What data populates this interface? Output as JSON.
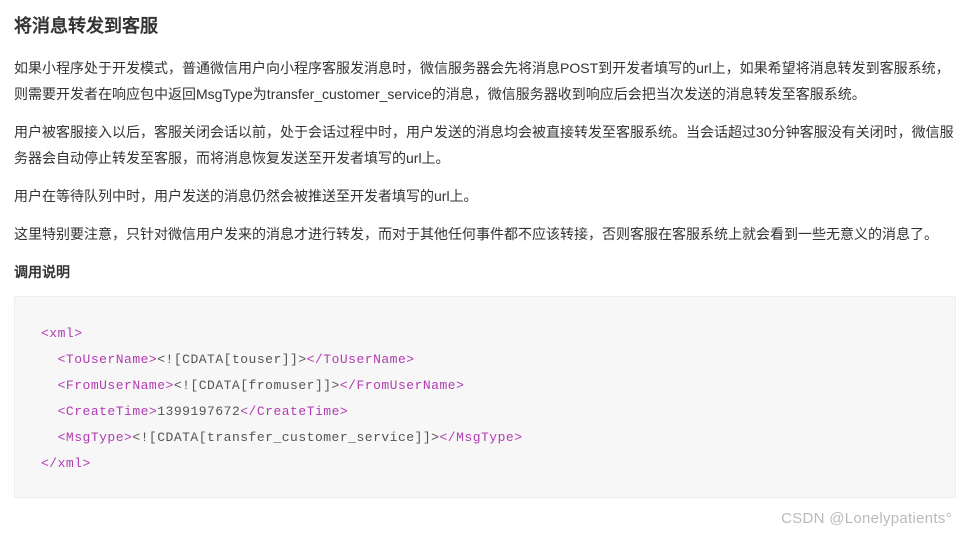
{
  "heading": "将消息转发到客服",
  "paragraphs": {
    "p1": "如果小程序处于开发模式，普通微信用户向小程序客服发消息时，微信服务器会先将消息POST到开发者填写的url上，如果希望将消息转发到客服系统，则需要开发者在响应包中返回MsgType为transfer_customer_service的消息，微信服务器收到响应后会把当次发送的消息转发至客服系统。",
    "p2": "用户被客服接入以后，客服关闭会话以前，处于会话过程中时，用户发送的消息均会被直接转发至客服系统。当会话超过30分钟客服没有关闭时，微信服务器会自动停止转发至客服，而将消息恢复发送至开发者填写的url上。",
    "p3": "用户在等待队列中时，用户发送的消息仍然会被推送至开发者填写的url上。",
    "p4": "这里特别要注意，只针对微信用户发来的消息才进行转发，而对于其他任何事件都不应该转接，否则客服在客服系统上就会看到一些无意义的消息了。"
  },
  "subheading": "调用说明",
  "code": {
    "open_xml": "<xml>",
    "to_open": "<ToUserName>",
    "to_text": "<![CDATA[touser]]>",
    "to_close": "</ToUserName>",
    "from_open": "<FromUserName>",
    "from_text": "<![CDATA[fromuser]]>",
    "from_close": "</FromUserName>",
    "time_open": "<CreateTime>",
    "time_text": "1399197672",
    "time_close": "</CreateTime>",
    "msg_open": "<MsgType>",
    "msg_text": "<![CDATA[transfer_customer_service]]>",
    "msg_close": "</MsgType>",
    "close_xml": "</xml>"
  },
  "watermark": "CSDN @Lonelypatients°"
}
